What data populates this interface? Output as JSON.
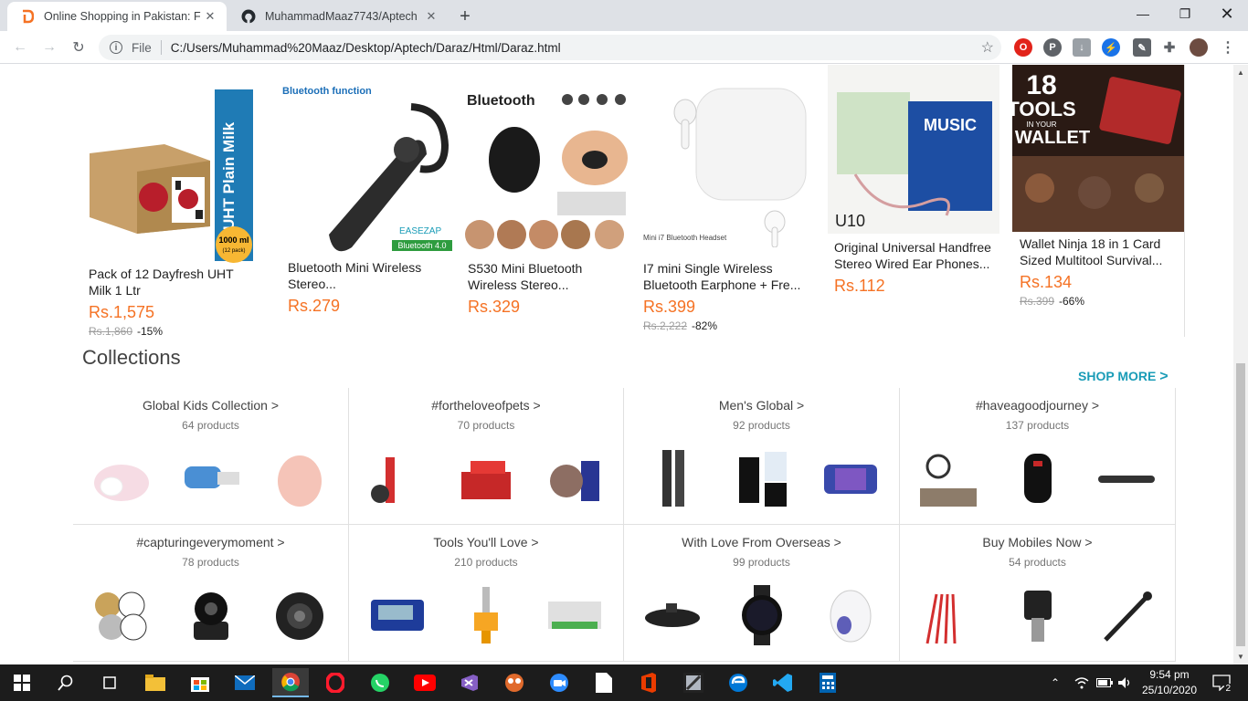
{
  "browser": {
    "tabs": [
      {
        "title": "Online Shopping in Pakistan: Fast",
        "active": true
      },
      {
        "title": "MuhammadMaaz7743/Aptech",
        "active": false
      }
    ],
    "address": {
      "scheme": "File",
      "url": "C:/Users/Muhammad%20Maaz/Desktop/Aptech/Daraz/Html/Daraz.html"
    }
  },
  "products": [
    {
      "name": "Pack of 12 Dayfresh UHT Milk 1 Ltr",
      "price": "Rs.1,575",
      "old_price": "Rs.1,860",
      "discount": "-15%"
    },
    {
      "name": "Bluetooth Mini Wireless Stereo...",
      "price": "Rs.279",
      "old_price": "",
      "discount": ""
    },
    {
      "name": "S530 Mini Bluetooth Wireless Stereo...",
      "price": "Rs.329",
      "old_price": "",
      "discount": ""
    },
    {
      "name": "I7 mini Single Wireless Bluetooth Earphone + Fre...",
      "price": "Rs.399",
      "old_price": "Rs.2,222",
      "discount": "-82%"
    },
    {
      "name": "Original Universal Handfree Stereo Wired Ear Phones...",
      "price": "Rs.112",
      "old_price": "",
      "discount": ""
    },
    {
      "name": "Wallet Ninja 18 in 1 Card Sized Multitool Survival...",
      "price": "Rs.134",
      "old_price": "Rs.399",
      "discount": "-66%"
    }
  ],
  "product_image_text": {
    "milk_side": "UHT Plain Milk",
    "milk_badge": "1000 ml",
    "milk_badge_sub": "(12 pack)",
    "bt_function": "Bluetooth function",
    "bt_brand": "EASEZAP",
    "bt_version": "Bluetooth 4.0",
    "s530_brand": "Bluetooth",
    "i7_caption": "Mini i7 Bluetooth Headset",
    "u10_label": "U10",
    "u10_box": "MUSIC",
    "wallet_18": "18",
    "wallet_tools": "TOOLS",
    "wallet_in": "IN YOUR",
    "wallet_wallet": "WALLET"
  },
  "collections": {
    "title": "Collections",
    "shop_more": "SHOP MORE",
    "items": [
      {
        "title": "Global Kids Collection >",
        "count": "64 products"
      },
      {
        "title": "#fortheloveofpets >",
        "count": "70 products"
      },
      {
        "title": "Men's Global >",
        "count": "92 products"
      },
      {
        "title": "#haveagoodjourney >",
        "count": "137 products"
      },
      {
        "title": "#capturingeverymoment >",
        "count": "78 products"
      },
      {
        "title": "Tools You'll Love >",
        "count": "210 products"
      },
      {
        "title": "With Love From Overseas >",
        "count": "99 products"
      },
      {
        "title": "Buy Mobiles Now >",
        "count": "54 products"
      }
    ]
  },
  "taskbar": {
    "time": "9:54 pm",
    "date": "25/10/2020",
    "notifications": "2"
  },
  "colors": {
    "price_orange": "#f57224",
    "shop_more_teal": "#1a9cb7",
    "taskbar_bg": "#1c1c1c",
    "tabstrip_bg": "#dee1e6"
  }
}
